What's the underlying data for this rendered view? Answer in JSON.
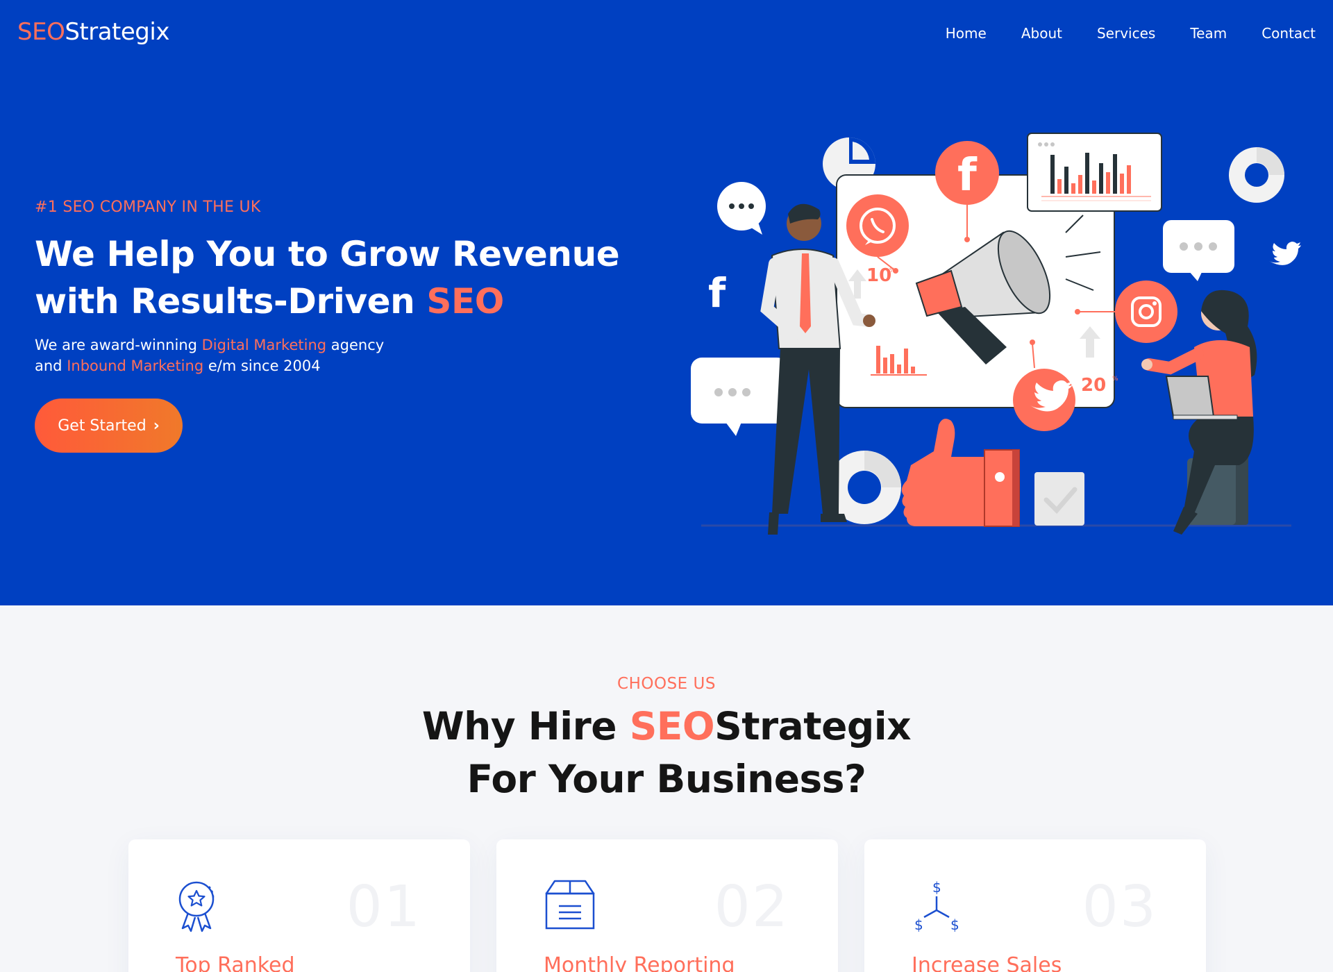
{
  "brand": {
    "logo_accent": "SEO",
    "logo_rest": "Strategix"
  },
  "nav": {
    "items": [
      "Home",
      "About",
      "Services",
      "Team",
      "Contact"
    ]
  },
  "hero": {
    "eyebrow": "#1 SEO COMPANY IN THE UK",
    "headline_line1": "We Help You to Grow Revenue",
    "headline_line2_start": "with Results-Driven ",
    "headline_accent": "SEO",
    "sub_p1": "We are award-winning ",
    "sub_accent1": "Digital Marketing",
    "sub_p2": " agency",
    "sub_p3": "and ",
    "sub_accent2": "Inbound Marketing",
    "sub_p4": " e/m since 2004",
    "cta_label": "Get Started",
    "illustration_labels": {
      "stat_a": "10",
      "stat_b": "20",
      "percent": "%"
    }
  },
  "choose": {
    "tag": "CHOOSE US",
    "title_start": "Why Hire ",
    "title_accent": "SEO",
    "title_brand_rest": "Strategix",
    "title_line2": "For Your Business?",
    "cards": [
      {
        "num": "01",
        "title": "Top Ranked",
        "icon": "award-badge-icon"
      },
      {
        "num": "02",
        "title": "Monthly Reporting",
        "icon": "report-box-icon"
      },
      {
        "num": "03",
        "title": "Increase Sales",
        "icon": "sales-growth-icon"
      }
    ]
  },
  "colors": {
    "primary": "#0040c1",
    "accent": "#ff6f5b",
    "bg": "#f5f6f9",
    "icon_blue": "#1b4fd0"
  }
}
